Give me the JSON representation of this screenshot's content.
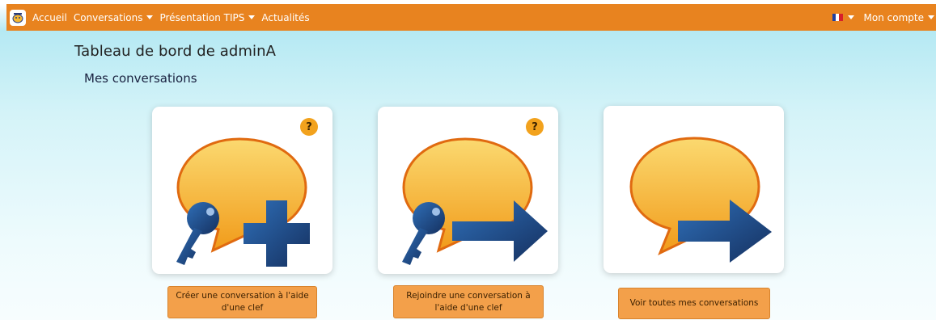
{
  "navbar": {
    "items": [
      {
        "label": "Accueil",
        "dropdown": false
      },
      {
        "label": "Conversations",
        "dropdown": true
      },
      {
        "label": "Présentation TIPS",
        "dropdown": true
      },
      {
        "label": "Actualités",
        "dropdown": false
      }
    ],
    "account_label": "Mon compte",
    "language_icon": "french-flag-icon",
    "background_color": "#e8831f"
  },
  "page": {
    "title": "Tableau de bord de adminA",
    "section_title": "Mes conversations"
  },
  "cards": [
    {
      "icon": "bubble-key-plus-icon",
      "help": "?",
      "button_label": "Créer une conversation à l'aide d'une clef"
    },
    {
      "icon": "bubble-key-arrow-icon",
      "help": "?",
      "button_label": "Rejoindre une conversation à l'aide d'une clef"
    },
    {
      "icon": "bubble-arrow-icon",
      "button_label": "Voir toutes mes conversations"
    }
  ],
  "colors": {
    "bubble": "#f6b52a",
    "bubble_outline": "#e06a10",
    "arrow": "#1e4f8a",
    "button": "#f3a04a"
  }
}
